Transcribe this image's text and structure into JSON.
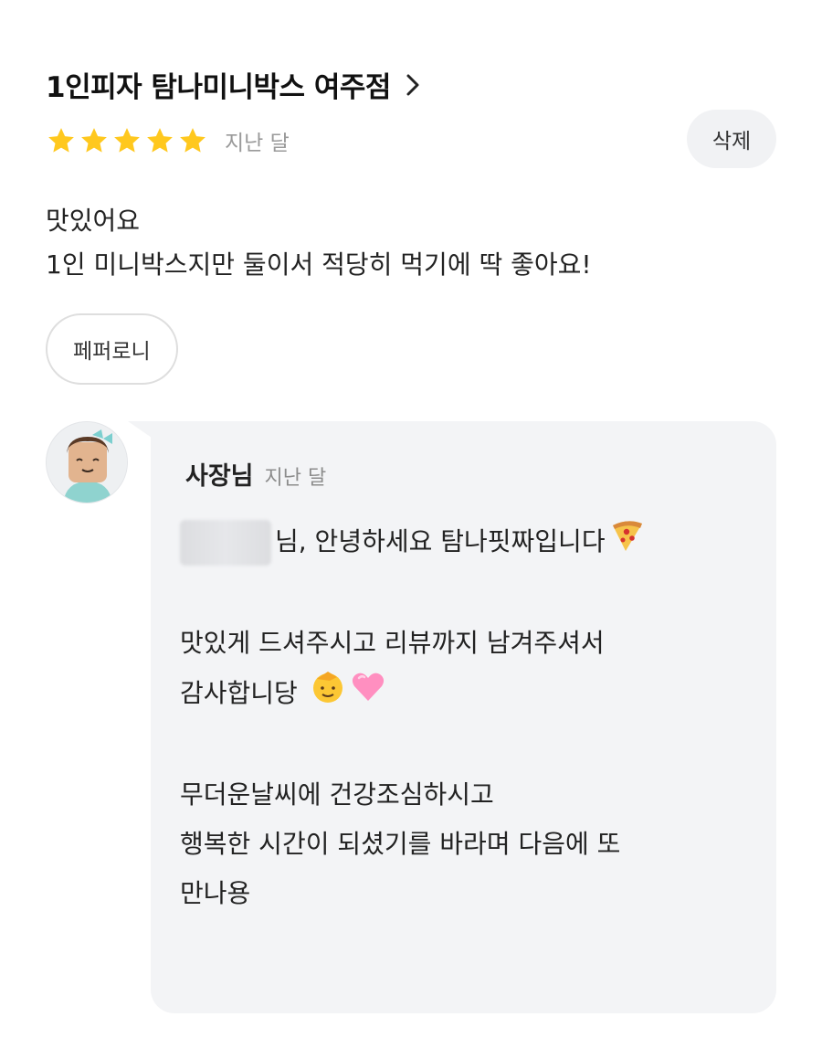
{
  "review": {
    "store_name": "1인피자 탐나미니박스 여주점",
    "rating": 5,
    "rating_max": 5,
    "date": "지난 달",
    "delete_label": "삭제",
    "text_line1": "맛있어요",
    "text_line2": "1인 미니박스지만 둘이서 적당히 먹기에 딱 좋아요!",
    "menu_tag": "페퍼로니"
  },
  "reply": {
    "author": "사장님",
    "date": "지난 달",
    "greeting": "님, 안녕하세요 탐나핏짜입니다",
    "line2": "맛있게 드셔주시고 리뷰까지 남겨주셔서",
    "line3": "감사합니당",
    "line4": "무더운날씨에 건강조심하시고",
    "line5": "행복한 시간이 되셨기를 바라며 다음에 또",
    "line6": "만나용"
  },
  "colors": {
    "star": "#FFC81E",
    "reply_bg": "#F3F4F6",
    "button_bg": "#F1F2F4",
    "muted_text": "#9A9A9A"
  },
  "icons": {
    "chevron": "chevron-right-icon",
    "star": "star-icon",
    "pizza": "pizza-emoji",
    "saluting_face": "saluting-face-emoji",
    "heart": "pink-heart-emoji"
  }
}
